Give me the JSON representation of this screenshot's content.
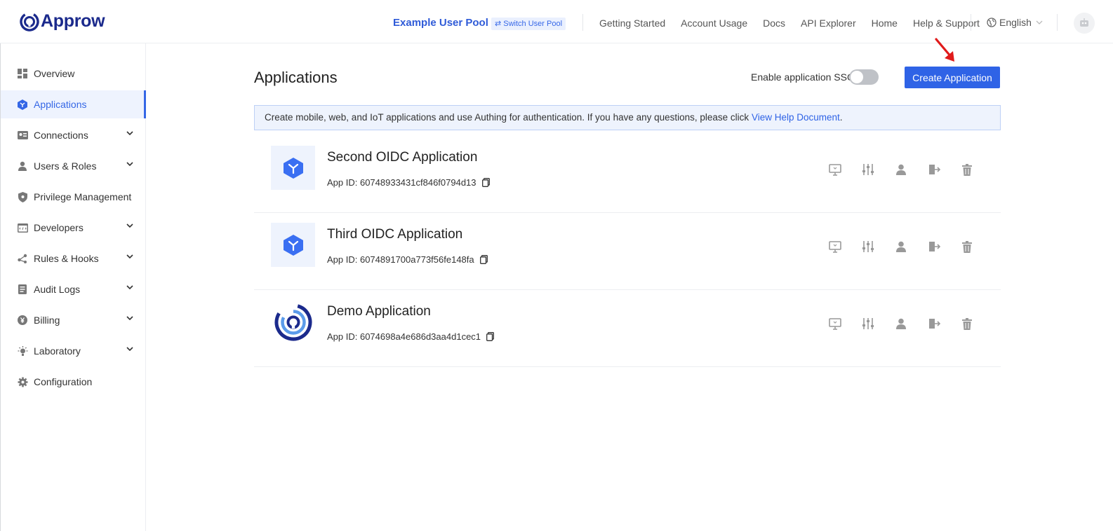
{
  "header": {
    "logo_text": "Approw",
    "pool_name": "Example User Pool",
    "switch_pool": "⇄ Switch User Pool",
    "nav": [
      "Getting Started",
      "Account Usage",
      "Docs",
      "API Explorer",
      "Home",
      "Help & Support"
    ],
    "language": "English"
  },
  "sidebar": {
    "items": [
      {
        "label": "Overview",
        "icon": "dashboard-icon",
        "expandable": false
      },
      {
        "label": "Applications",
        "icon": "cube-icon",
        "expandable": false,
        "active": true
      },
      {
        "label": "Connections",
        "icon": "id-card-icon",
        "expandable": true
      },
      {
        "label": "Users & Roles",
        "icon": "user-icon",
        "expandable": true
      },
      {
        "label": "Privilege Management",
        "icon": "shield-icon",
        "expandable": false
      },
      {
        "label": "Developers",
        "icon": "code-icon",
        "expandable": true
      },
      {
        "label": "Rules & Hooks",
        "icon": "share-icon",
        "expandable": true
      },
      {
        "label": "Audit Logs",
        "icon": "document-icon",
        "expandable": true
      },
      {
        "label": "Billing",
        "icon": "coin-icon",
        "expandable": true
      },
      {
        "label": "Laboratory",
        "icon": "bulb-icon",
        "expandable": true
      },
      {
        "label": "Configuration",
        "icon": "gear-icon",
        "expandable": false
      }
    ]
  },
  "main": {
    "title": "Applications",
    "sso_label": "Enable application SSO",
    "sso_enabled": false,
    "create_button": "Create Application",
    "notice_text": "Create mobile, web, and IoT applications and use Authing for authentication. If you have any questions, please click ",
    "notice_link": "View Help Document",
    "notice_end": ".",
    "apps": [
      {
        "name": "Second OIDC Application",
        "app_id": "App ID: 60748933431cf846f0794d13",
        "logo": "cube"
      },
      {
        "name": "Third OIDC Application",
        "app_id": "App ID: 6074891700a773f56fe148fa",
        "logo": "cube"
      },
      {
        "name": "Demo Application",
        "app_id": "App ID: 6074698a4e686d3aa4d1cec1",
        "logo": "brand"
      }
    ]
  },
  "colors": {
    "accent": "#2f63e6",
    "brand_dark": "#1b2a8c",
    "annotation_arrow": "#e01b1b"
  }
}
